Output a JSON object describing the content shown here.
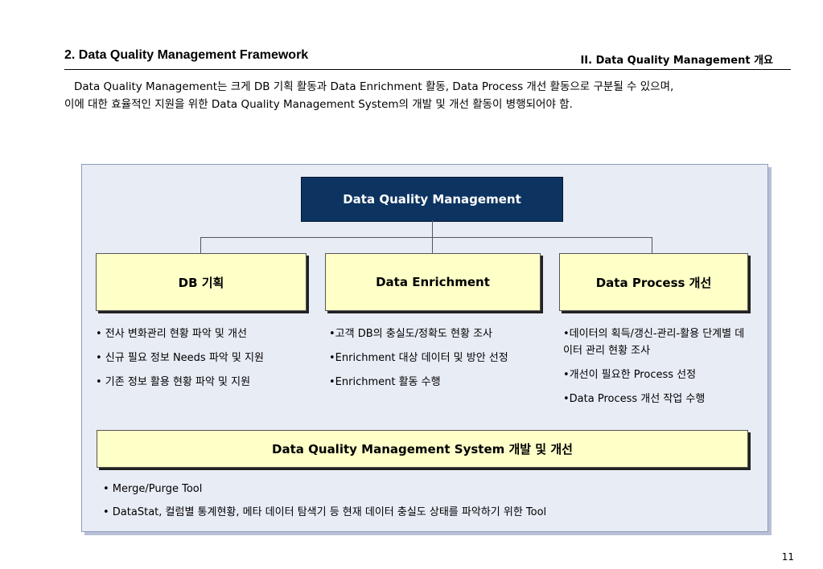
{
  "header": {
    "title": "2.  Data Quality Management Framework",
    "section": "II.  Data Quality Management 개요"
  },
  "intro": {
    "line1": "Data Quality Management는 크게 DB 기획 활동과 Data Enrichment 활동, Data Process 개선 활동으로 구분될 수 있으며,",
    "line2": "이에 대한 효율적인 지원을 위한 Data Quality Management System의 개발 및 개선 활동이 병행되어야 함."
  },
  "diagram": {
    "root": "Data Quality Management",
    "branches": [
      {
        "label": "DB 기획",
        "items": [
          "• 전사 변화관리 현황 파악 및 개선",
          "• 신규 필요 정보 Needs 파악 및 지원",
          "• 기존 정보 활용 현황 파악 및 지원"
        ]
      },
      {
        "label": "Data Enrichment",
        "items": [
          "•고객 DB의 충실도/정확도 현황 조사",
          "•Enrichment 대상 데이터 및 방안 선정",
          "•Enrichment 활동 수행"
        ]
      },
      {
        "label": "Data Process 개선",
        "items": [
          "•데이터의 획득/갱신-관리-활용 단계별 데이터 관리 현황 조사",
          "•개선이 필요한 Process 선정",
          "•Data Process 개선 작업 수행"
        ]
      }
    ],
    "system": {
      "label": "Data Quality Management System 개발 및 개선",
      "items": [
        "• Merge/Purge Tool",
        "• DataStat, 컬럼별 통계현황, 메타 데이터 탐색기 등 현재 데이터 충실도 상태를 파악하기 위한 Tool"
      ]
    }
  },
  "footer": {
    "page_number": "11"
  }
}
